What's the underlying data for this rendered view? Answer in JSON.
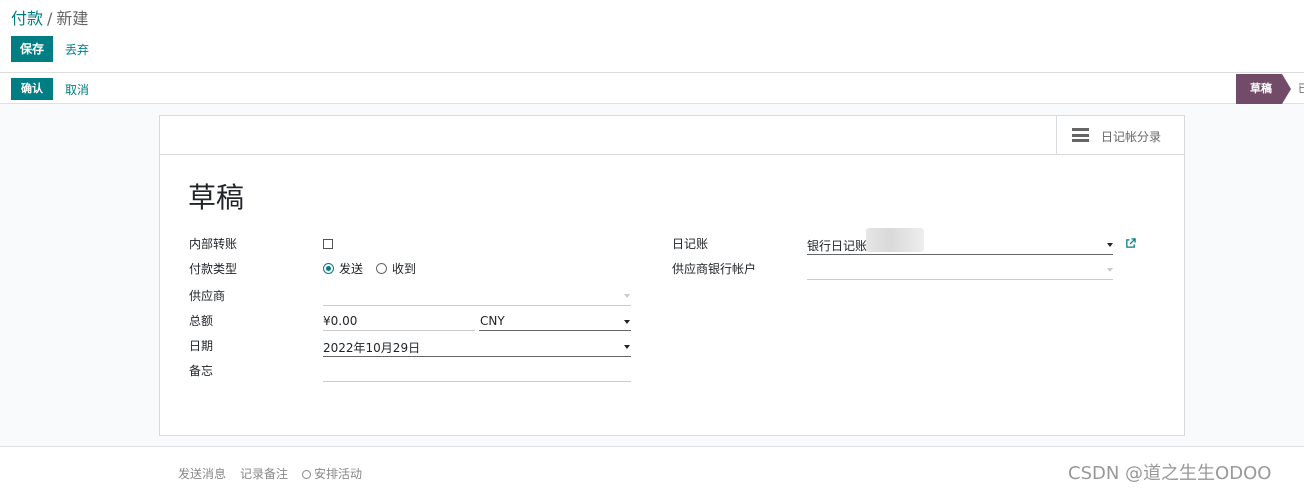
{
  "breadcrumb": {
    "parent": "付款",
    "separator": "/",
    "current": "新建"
  },
  "actions": {
    "save": "保存",
    "discard": "丢弃"
  },
  "statusbar": {
    "confirm": "确认",
    "cancel": "取消",
    "stage_active": "草稿",
    "stage_next": "已"
  },
  "button_box": {
    "journal_entries": "日记帐分录"
  },
  "form": {
    "title": "草稿",
    "left": {
      "internal_transfer_label": "内部转账",
      "internal_transfer_checked": false,
      "payment_type_label": "付款类型",
      "payment_type_options": [
        "发送",
        "收到"
      ],
      "payment_type_selected": "发送",
      "partner_label": "供应商",
      "partner_value": "",
      "amount_label": "总额",
      "amount_value": "¥0.00",
      "currency_value": "CNY",
      "date_label": "日期",
      "date_value": "2022年10月29日",
      "memo_label": "备忘",
      "memo_value": ""
    },
    "right": {
      "journal_label": "日记账",
      "journal_value": "银行日记账",
      "bank_account_label": "供应商银行帐户",
      "bank_account_value": ""
    }
  },
  "chatter": {
    "send_message": "发送消息",
    "log_note": "记录备注",
    "schedule_activity": "安排活动"
  },
  "watermark": "CSDN @道之生生ODOO",
  "colors": {
    "primary": "#017e84",
    "stage": "#714b67"
  }
}
